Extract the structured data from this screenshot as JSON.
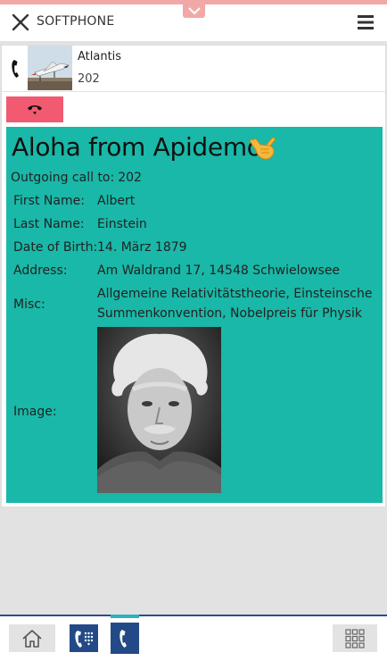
{
  "header": {
    "title": "SOFTPHONE"
  },
  "call": {
    "name": "Atlantis",
    "number": "202"
  },
  "card": {
    "heading": "Aloha from Apidemo",
    "outgoing_label": "Outgoing call to:",
    "outgoing_number": "202",
    "fields": {
      "first_name": {
        "label": "First Name:",
        "value": "Albert"
      },
      "last_name": {
        "label": "Last Name:",
        "value": "Einstein"
      },
      "dob": {
        "label": "Date of Birth:",
        "value": "14. März 1879"
      },
      "address": {
        "label": "Address:",
        "value": "Am Waldrand 17, 14548 Schwielowsee"
      },
      "misc": {
        "label": "Misc:",
        "value": "Allgemeine Relativitätstheorie, Einsteinsche Summenkonvention, Nobelpreis für Physik"
      },
      "image": {
        "label": "Image:"
      }
    }
  },
  "icons": {
    "close": "close-icon",
    "menu": "hamburger-menu-icon",
    "tab_handle": "chevron-down-icon",
    "phone": "phone-icon",
    "hangup": "hangup-icon",
    "emoji": "call-me-hand-emoji",
    "home": "home-icon",
    "dialpad": "dialpad-phone-icon",
    "active_call": "phone-icon",
    "keypad": "keypad-grid-icon"
  },
  "colors": {
    "accent_pink": "#f3a8a8",
    "hangup_red": "#f25a72",
    "card_teal": "#19b8a8",
    "nav_blue": "#234a86",
    "active_tab": "#2fb1c2"
  }
}
